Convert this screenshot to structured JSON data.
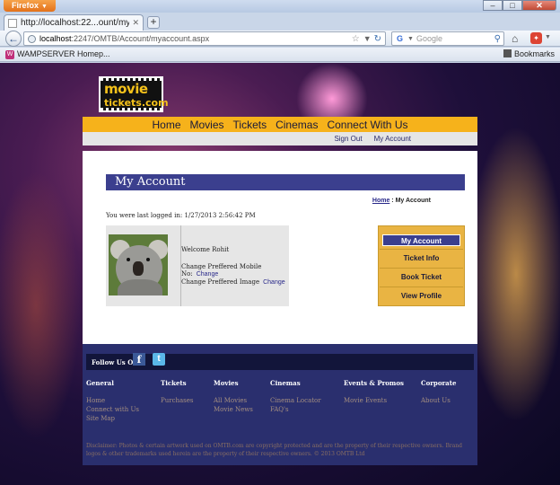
{
  "browser": {
    "app_button": "Firefox",
    "window_controls": {
      "minimize": "–",
      "maximize": "□",
      "close": "✕"
    },
    "tab": {
      "title": "http://localhost:22...ount/myaccount.aspx"
    },
    "url": {
      "host": "localhost",
      "path": ":2247/OMTB/Account/myaccount.aspx"
    },
    "search": {
      "engine": "G",
      "placeholder": "Google"
    },
    "bookmarks_bar": {
      "item": "WAMPSERVER Homep...",
      "menu_label": "Bookmarks"
    }
  },
  "site": {
    "logo": {
      "line1": "movie",
      "line2": "tickets.com"
    },
    "main_nav": [
      "Home",
      "Movies",
      "Tickets",
      "Cinemas",
      "Connect With Us"
    ],
    "sub_nav": [
      "Sign Out",
      "My Account"
    ],
    "page_title": "My Account",
    "breadcrumb": {
      "home": "Home",
      "separator": " : ",
      "current": "My Account"
    },
    "last_login": "You were last logged in: 1/27/2013 2:56:42 PM",
    "profile": {
      "welcome": "Welcome Rohit",
      "mobile_label": "Change Preffered Mobile No:",
      "mobile_link": "Change",
      "image_label": "Change Preffered Image",
      "image_link": "Change"
    },
    "side_menu": [
      "My Account",
      "Ticket Info",
      "Book Ticket",
      "View Profile"
    ],
    "footer": {
      "follow_label": "Follow Us On",
      "columns": [
        {
          "heading": "General",
          "links": [
            "Home",
            "Connect with Us",
            "Site Map"
          ]
        },
        {
          "heading": "Tickets",
          "links": [
            "Purchases"
          ]
        },
        {
          "heading": "Movies",
          "links": [
            "All Movies",
            "Movie News"
          ]
        },
        {
          "heading": "Cinemas",
          "links": [
            "Cinema Locator",
            "FAQ's"
          ]
        },
        {
          "heading": "Events & Promos",
          "links": [
            "Movie Events"
          ]
        },
        {
          "heading": "Corporate",
          "links": [
            "About Us"
          ]
        }
      ],
      "disclaimer": "Disclaimer: Photos & certain artwork used on OMTB.com are copyright protected and are the property of their respective owners. Brand logos & other trademarks used herein are the property of their respective owners. © 2013 OMTB Ltd"
    }
  },
  "colors": {
    "nav_gold": "#f6b21b",
    "title_navy": "#3b3f8e",
    "footer_navy": "#2a2f6e",
    "side_menu_gold": "#e9b443"
  }
}
